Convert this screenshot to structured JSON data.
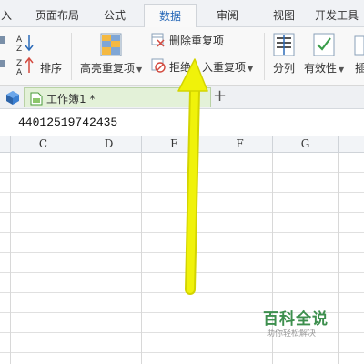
{
  "menu_tabs": [
    "入",
    "页面布局",
    "公式",
    "数据",
    "审阅",
    "视图",
    "开发工具"
  ],
  "active_tab": "数据",
  "ribbon": {
    "sort_label": "排序",
    "highlight_dupes_label": "高亮重复项",
    "delete_dupes_label": "删除重复项",
    "reject_dupes_label_a": "拒绝",
    "reject_dupes_label_b": "入重复项",
    "text_to_columns_label": "分列",
    "validity_label": "有效性",
    "partial_label": "插"
  },
  "workbook": {
    "tab_label": "工作簿1 *",
    "add_tab": "+"
  },
  "formula_bar": {
    "value": "44012519742435"
  },
  "columns": [
    "C",
    "D",
    "E",
    "F",
    "G"
  ],
  "watermark": {
    "title": "百科全说",
    "subtitle": "助你轻松解决"
  },
  "colors": {
    "arrow": "#f0f20a",
    "accent": "#2a6ab8",
    "watermark": "#3d8f4e"
  }
}
